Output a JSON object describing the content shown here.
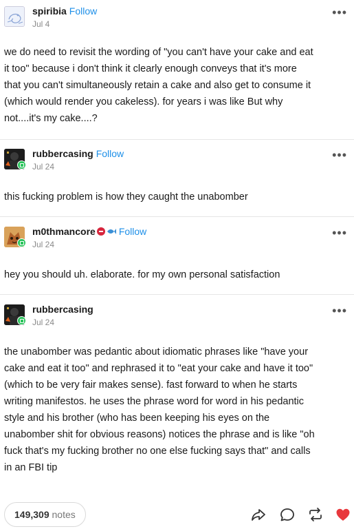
{
  "posts": [
    {
      "username": "spiribia",
      "follow": "Follow",
      "date": "Jul 4",
      "more": "•••",
      "lines": [
        "we do need to revisit the wording of \"you can't have your cake and eat",
        "it too\" because i don't think it clearly enough conveys that it's more",
        "that you can't simultaneously retain a cake and also get to consume it",
        "(which would render you cakeless). for years i was like But why",
        "not....it's my cake....?"
      ]
    },
    {
      "username": "rubbercasing",
      "follow": "Follow",
      "date": "Jul 24",
      "more": "•••",
      "lines": [
        "this fucking problem is how they caught the unabomber"
      ]
    },
    {
      "username": "m0thmancore",
      "follow": "Follow",
      "date": "Jul 24",
      "more": "•••",
      "lines": [
        "hey you should uh. elaborate. for my own personal satisfaction"
      ]
    },
    {
      "username": "rubbercasing",
      "date": "Jul 24",
      "more": "•••",
      "lines": [
        "the unabomber was pedantic about idiomatic phrases like \"have your",
        "cake and eat it too\" and rephrased it to \"eat your cake and have it too\"",
        "(which to be very fair makes sense). fast forward to when he starts",
        "writing manifestos. he uses the phrase word for word in his pedantic",
        "style and his brother (who has been keeping his eyes on the",
        "unabomber shit for obvious reasons) notices the phrase and is like \"oh",
        "fuck that's my fucking brother no one else fucking says that\" and calls",
        "in an FBI tip"
      ]
    }
  ],
  "footer": {
    "notes_count": "149,309",
    "notes_label": "notes",
    "actions": [
      "share-icon",
      "reply-icon",
      "reblog-icon",
      "like-icon"
    ]
  },
  "colors": {
    "follow": "#1d8fe8",
    "online_dot": "#2bc45c",
    "like": "#e8383d",
    "text": "#1a1a1a",
    "muted": "#8a8a8a"
  }
}
